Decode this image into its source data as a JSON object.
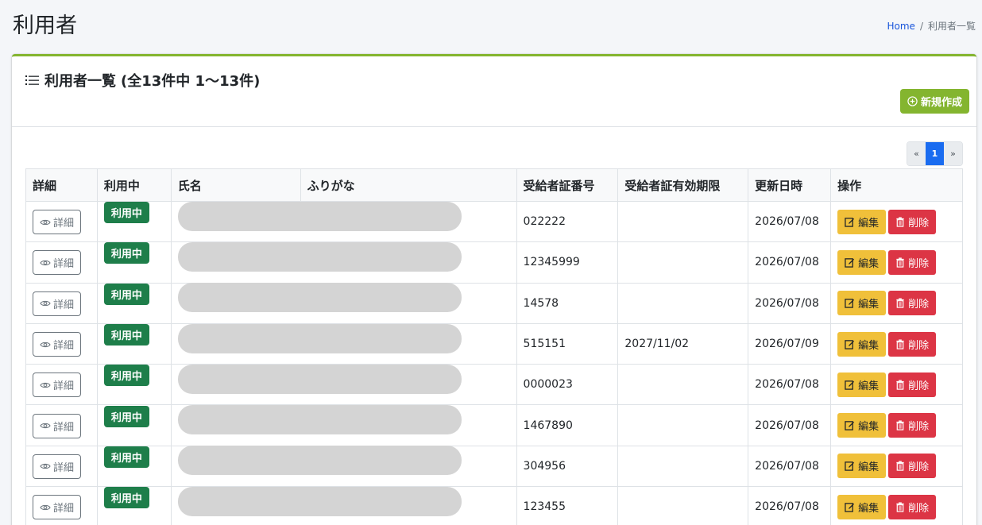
{
  "page": {
    "title": "利用者",
    "breadcrumb": {
      "home": "Home",
      "sep": "/",
      "current": "利用者一覧"
    }
  },
  "card": {
    "title": "利用者一覧",
    "count": "(全13件中 1〜13件)",
    "new_button": "新規作成",
    "accent_color": "#84b52f"
  },
  "pager": {
    "prev": "«",
    "current": "1",
    "next": "»"
  },
  "table": {
    "headers": [
      "詳細",
      "利用中",
      "氏名",
      "ふりがな",
      "受給者証番号",
      "受給者証有効期限",
      "更新日時",
      "操作"
    ],
    "detail_label": "詳細",
    "status_label": "利用中",
    "edit_label": "編集",
    "delete_label": "削除",
    "rows": [
      {
        "number": "022222",
        "expiry": "",
        "updated": "2026/07/08"
      },
      {
        "number": "12345999",
        "expiry": "",
        "updated": "2026/07/08"
      },
      {
        "number": "14578",
        "expiry": "",
        "updated": "2026/07/08"
      },
      {
        "number": "515151",
        "expiry": "2027/11/02",
        "updated": "2026/07/09"
      },
      {
        "number": "0000023",
        "expiry": "",
        "updated": "2026/07/08"
      },
      {
        "number": "1467890",
        "expiry": "",
        "updated": "2026/07/08"
      },
      {
        "number": "304956",
        "expiry": "",
        "updated": "2026/07/08"
      },
      {
        "number": "123455",
        "expiry": "",
        "updated": "2026/07/08"
      }
    ]
  }
}
